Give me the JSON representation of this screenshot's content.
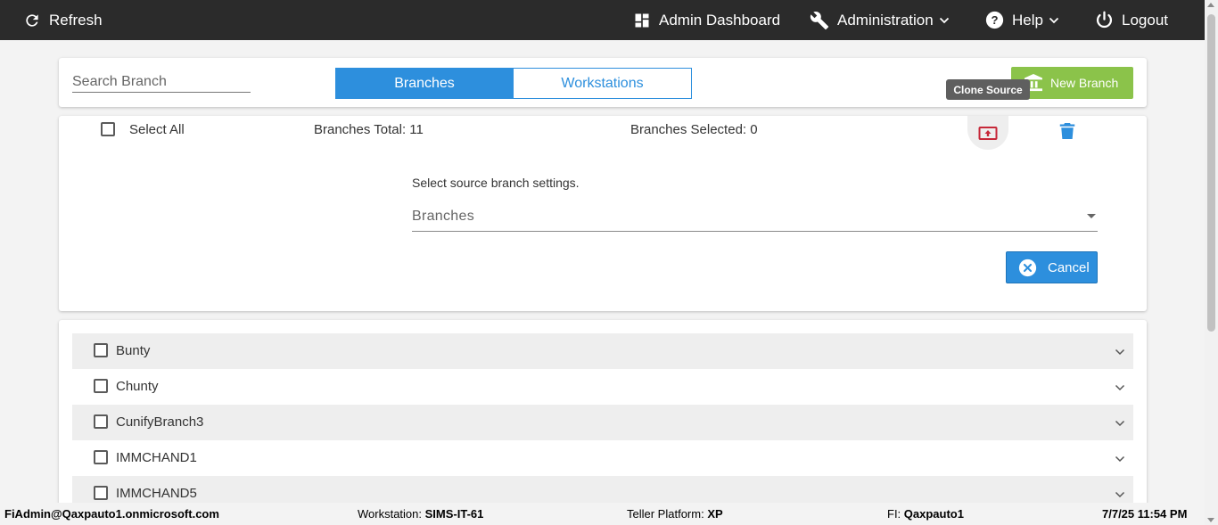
{
  "topbar": {
    "refresh_label": "Refresh",
    "admin_dashboard_label": "Admin Dashboard",
    "administration_label": "Administration",
    "help_label": "Help",
    "logout_label": "Logout"
  },
  "header": {
    "search_placeholder": "Search Branch",
    "tabs": [
      {
        "label": "Branches",
        "active": true
      },
      {
        "label": "Workstations",
        "active": false
      }
    ],
    "new_branch_label": "New Branch",
    "tooltip": "Clone Source"
  },
  "actions": {
    "select_all_label": "Select All",
    "branches_total_label": "Branches Total: 11",
    "branches_selected_label": "Branches Selected: 0",
    "source_prompt": "Select source branch settings.",
    "source_select_value": "Branches",
    "cancel_label": "Cancel"
  },
  "branches": [
    {
      "label": "Bunty"
    },
    {
      "label": "Chunty"
    },
    {
      "label": "CunifyBranch3"
    },
    {
      "label": "IMMCHAND1"
    },
    {
      "label": "IMMCHAND5"
    }
  ],
  "status": {
    "user": "FiAdmin@Qaxpauto1.onmicrosoft.com",
    "workstation_label": "Workstation:",
    "workstation_value": "SIMS-IT-61",
    "platform_label": "Teller Platform:",
    "platform_value": "XP",
    "fi_label": "FI:",
    "fi_value": "Qaxpauto1",
    "datetime": "7/7/25 11:54 PM"
  },
  "colors": {
    "topbar": "#2b2b2b",
    "primary": "#2d8fdd",
    "success": "#8bc34a",
    "clone_icon": "#c62839",
    "trash_icon": "#2d8fdd"
  },
  "icons": {
    "refresh": "refresh-icon",
    "dashboard": "dashboard-icon",
    "administration": "wrench-icon",
    "help": "help-circle-icon",
    "logout": "power-icon",
    "new_branch": "bank-icon",
    "clone": "clone-upload-icon",
    "delete": "trash-icon",
    "cancel": "close-circle-icon",
    "expand": "chevron-down-icon"
  }
}
